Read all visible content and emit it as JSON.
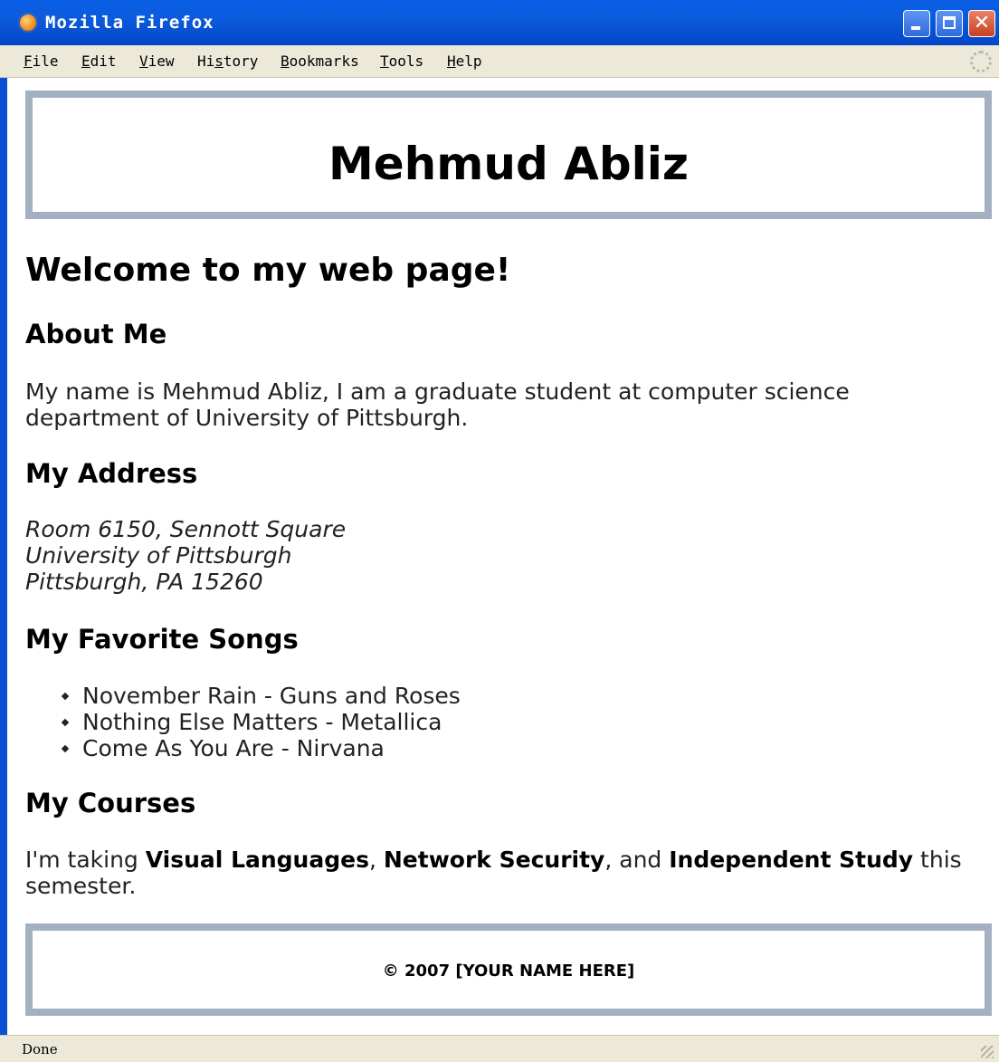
{
  "window": {
    "title": "Mozilla Firefox"
  },
  "menu": {
    "file": {
      "acc": "F",
      "rest": "ile"
    },
    "edit": {
      "acc": "E",
      "rest": "dit"
    },
    "view": {
      "acc": "V",
      "rest": "iew"
    },
    "history": {
      "pre": "Hi",
      "acc": "s",
      "rest": "tory"
    },
    "bookmarks": {
      "acc": "B",
      "rest": "ookmarks"
    },
    "tools": {
      "acc": "T",
      "rest": "ools"
    },
    "help": {
      "acc": "H",
      "rest": "elp"
    }
  },
  "page": {
    "header_name": "Mehmud Abliz",
    "welcome": "Welcome to my web page!",
    "about": {
      "heading": "About Me",
      "text": "My name is Mehmud Abliz, I am a graduate student at computer science department of University of Pittsburgh."
    },
    "address": {
      "heading": "My Address",
      "line1": "Room 6150, Sennott Square",
      "line2": "University of Pittsburgh",
      "line3": "Pittsburgh, PA 15260"
    },
    "songs": {
      "heading": "My Favorite Songs",
      "items": [
        "November Rain - Guns and Roses",
        "Nothing Else Matters - Metallica",
        "Come As You Are - Nirvana"
      ]
    },
    "courses": {
      "heading": "My Courses",
      "intro": "I'm taking ",
      "c1": "Visual Languages",
      "sep1": ", ",
      "c2": "Network Security",
      "sep2": ", and ",
      "c3": "Independent Study",
      "outro": " this semester."
    },
    "footer": "© 2007 [YOUR NAME HERE]"
  },
  "status": {
    "text": "Done"
  }
}
